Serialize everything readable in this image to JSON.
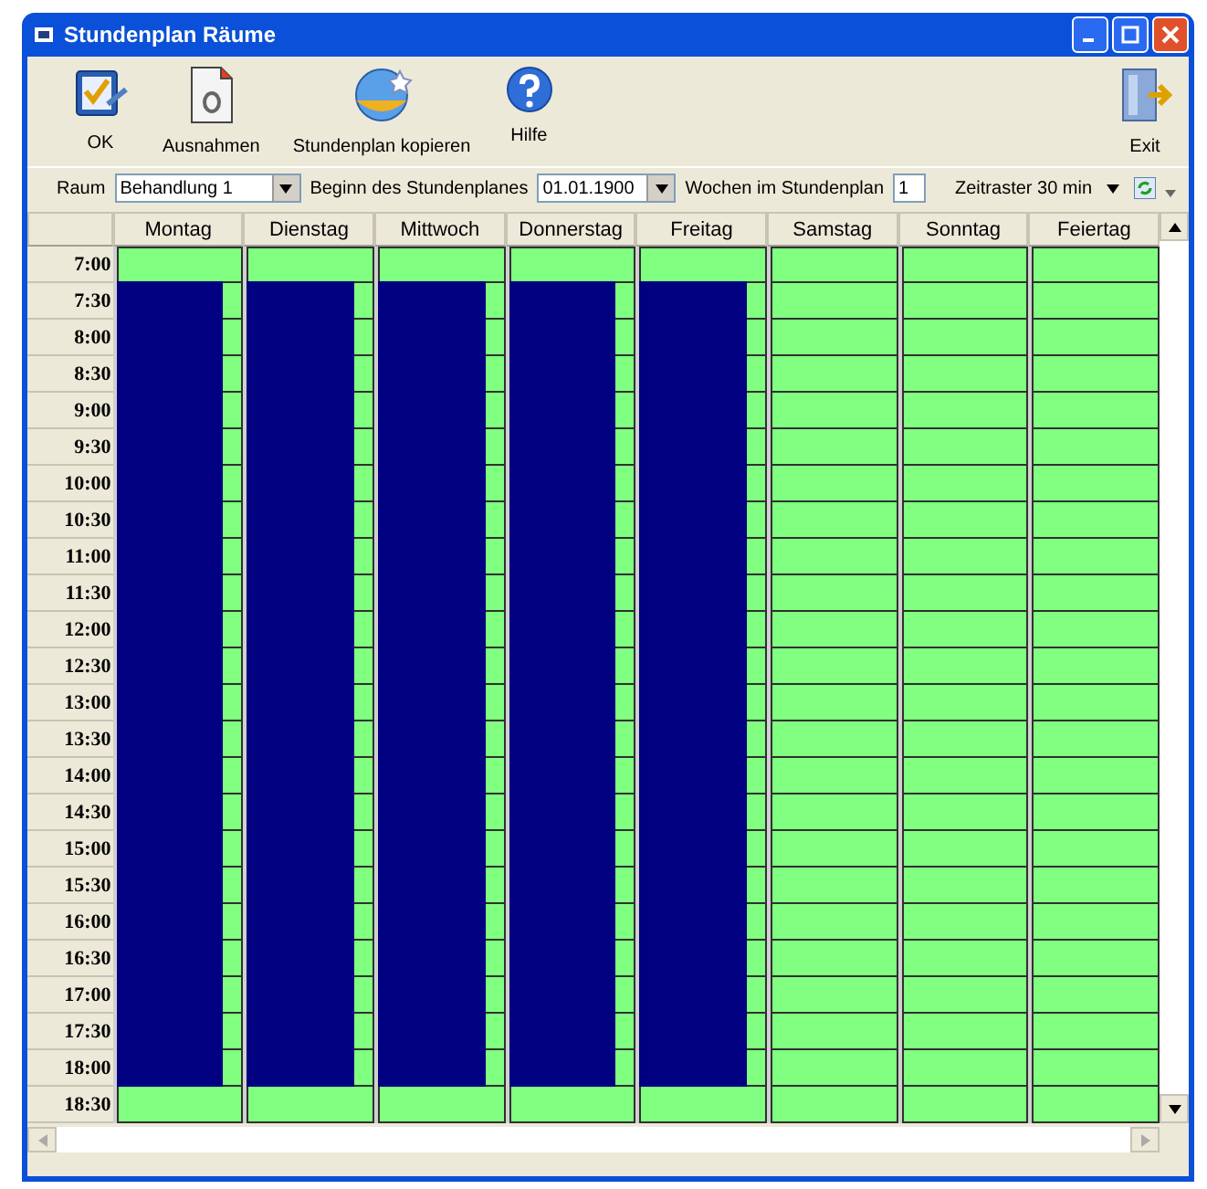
{
  "window": {
    "title": "Stundenplan Räume"
  },
  "toolbar": [
    {
      "kind": "ok",
      "label": "OK"
    },
    {
      "kind": "exceptions",
      "label": "Ausnahmen"
    },
    {
      "kind": "copy",
      "label": "Stundenplan kopieren"
    },
    {
      "kind": "help",
      "label": "Hilfe"
    },
    {
      "kind": "exit",
      "label": "Exit"
    }
  ],
  "filter_bar": {
    "room_label": "Raum",
    "room": "Behandlung 1",
    "start_label": "Beginn des Stundenplanes",
    "start": "01.01.1900",
    "weeks_label": "Wochen im Stundenplan",
    "weeks": "1",
    "raster": "Zeitraster 30 min"
  },
  "times": [
    "7:00",
    "7:30",
    "8:00",
    "8:30",
    "9:00",
    "9:30",
    "10:00",
    "10:30",
    "11:00",
    "11:30",
    "12:00",
    "12:30",
    "13:00",
    "13:30",
    "14:00",
    "14:30",
    "15:00",
    "15:30",
    "16:00",
    "16:30",
    "17:00",
    "17:30",
    "18:00",
    "18:30"
  ],
  "days": [
    {
      "name": "Montag",
      "booked": [
        false,
        true,
        true,
        true,
        true,
        true,
        true,
        true,
        true,
        true,
        true,
        true,
        true,
        true,
        true,
        true,
        true,
        true,
        true,
        true,
        true,
        true,
        true,
        false
      ]
    },
    {
      "name": "Dienstag",
      "booked": [
        false,
        true,
        true,
        true,
        true,
        true,
        true,
        true,
        true,
        true,
        true,
        true,
        true,
        true,
        true,
        true,
        true,
        true,
        true,
        true,
        true,
        true,
        true,
        false
      ]
    },
    {
      "name": "Mittwoch",
      "booked": [
        false,
        true,
        true,
        true,
        true,
        true,
        true,
        true,
        true,
        true,
        true,
        true,
        true,
        true,
        true,
        true,
        true,
        true,
        true,
        true,
        true,
        true,
        true,
        false
      ]
    },
    {
      "name": "Donnerstag",
      "booked": [
        false,
        true,
        true,
        true,
        true,
        true,
        true,
        true,
        true,
        true,
        true,
        true,
        true,
        true,
        true,
        true,
        true,
        true,
        true,
        true,
        true,
        true,
        true,
        false
      ]
    },
    {
      "name": "Freitag",
      "booked": [
        false,
        true,
        true,
        true,
        true,
        true,
        true,
        true,
        true,
        true,
        true,
        true,
        true,
        true,
        true,
        true,
        true,
        true,
        true,
        true,
        true,
        true,
        true,
        false
      ]
    },
    {
      "name": "Samstag",
      "booked": [
        false,
        false,
        false,
        false,
        false,
        false,
        false,
        false,
        false,
        false,
        false,
        false,
        false,
        false,
        false,
        false,
        false,
        false,
        false,
        false,
        false,
        false,
        false,
        false
      ]
    },
    {
      "name": "Sonntag",
      "booked": [
        false,
        false,
        false,
        false,
        false,
        false,
        false,
        false,
        false,
        false,
        false,
        false,
        false,
        false,
        false,
        false,
        false,
        false,
        false,
        false,
        false,
        false,
        false,
        false
      ]
    },
    {
      "name": "Feiertag",
      "booked": [
        false,
        false,
        false,
        false,
        false,
        false,
        false,
        false,
        false,
        false,
        false,
        false,
        false,
        false,
        false,
        false,
        false,
        false,
        false,
        false,
        false,
        false,
        false,
        false
      ]
    }
  ]
}
